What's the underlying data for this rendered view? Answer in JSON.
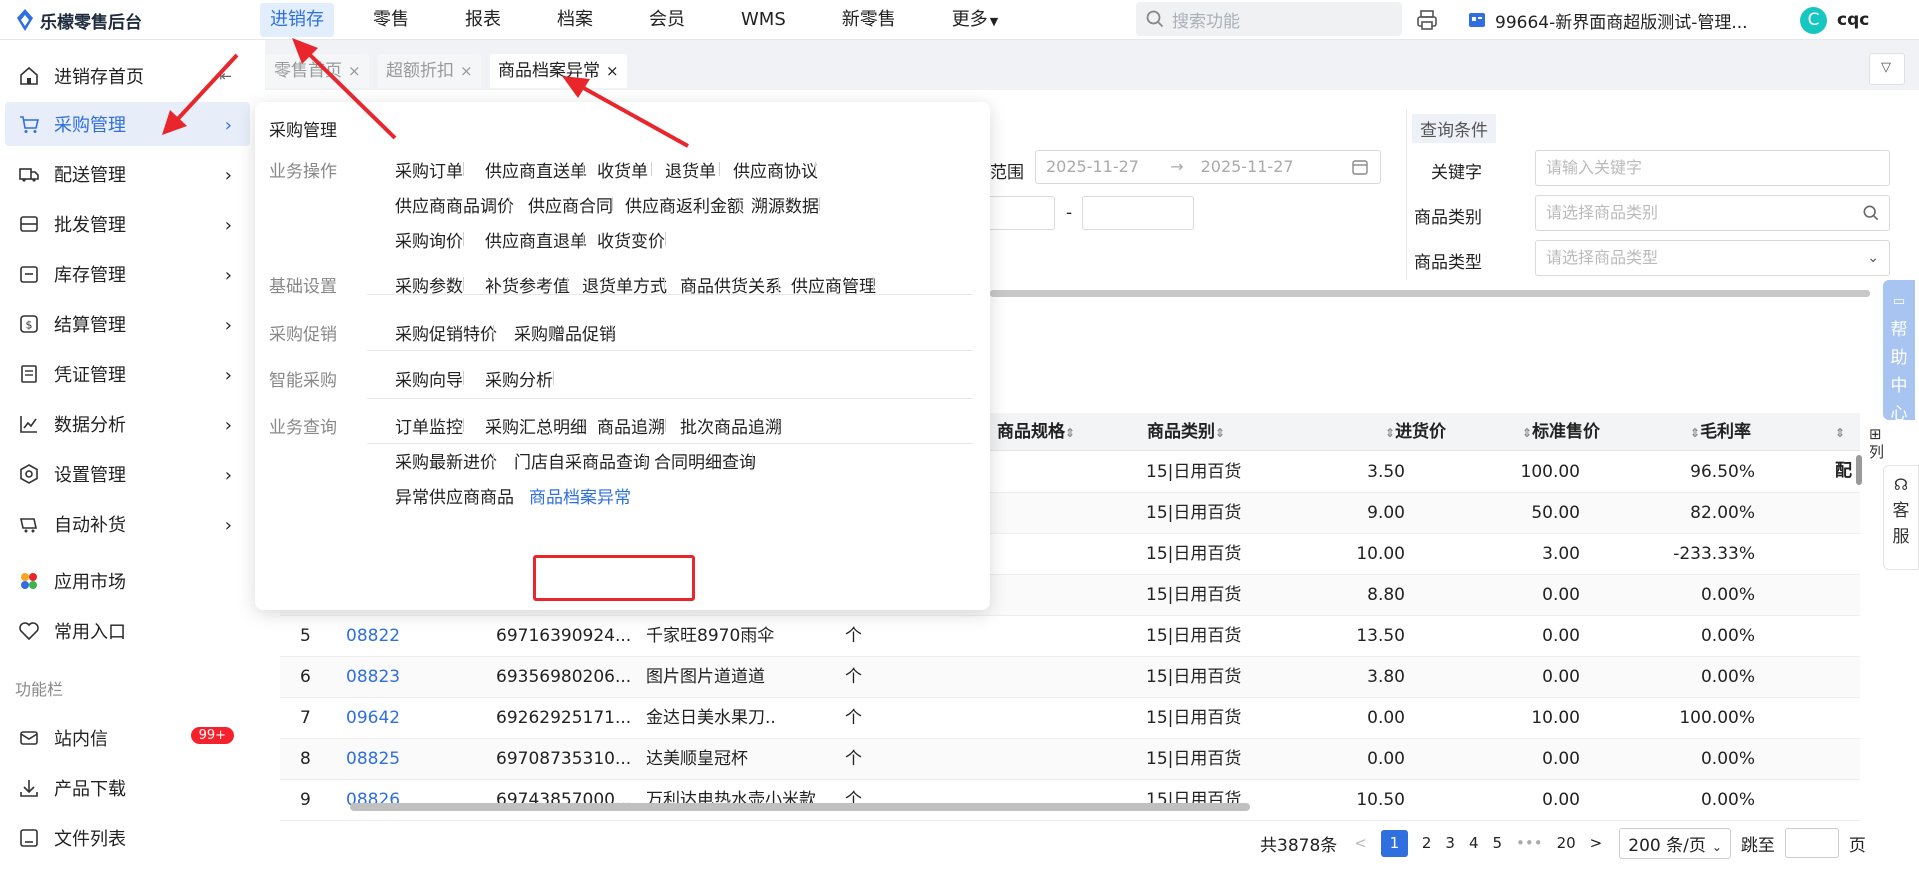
{
  "app": {
    "title": "乐檬零售后台"
  },
  "nav": [
    "进销存",
    "零售",
    "报表",
    "档案",
    "会员",
    "WMS",
    "新零售",
    "更多"
  ],
  "search": {
    "placeholder": "搜索功能"
  },
  "store": "99664-新界面商超版测试-管理...",
  "user": {
    "avatar": "C",
    "name": "cqc"
  },
  "sidebar": {
    "items": [
      "进销存首页",
      "采购管理",
      "配送管理",
      "批发管理",
      "库存管理",
      "结算管理",
      "凭证管理",
      "数据分析",
      "设置管理",
      "自动补货"
    ],
    "extra": [
      "应用市场",
      "常用入口"
    ],
    "section": "功能栏",
    "tools": [
      "站内信",
      "产品下载",
      "文件列表"
    ],
    "badge": "99+"
  },
  "tabs": [
    {
      "label": "零售首页",
      "close": "×"
    },
    {
      "label": "超额折扣",
      "close": "×"
    },
    {
      "label": "商品档案异常",
      "close": "×"
    }
  ],
  "query": {
    "title": "查询条件",
    "range_label": "范围",
    "date_from": "2025-11-27",
    "date_arrow": "→",
    "date_to": "2025-11-27",
    "dash": "-",
    "keyword_label": "关键字",
    "keyword_placeholder": "请输入关键字",
    "category_label": "商品类别",
    "category_placeholder": "请选择商品类别",
    "type_label": "商品类型",
    "type_placeholder": "请选择商品类型"
  },
  "table": {
    "headers": [
      "商品规格",
      "商品类别",
      "进货价",
      "标准售价",
      "毛利率",
      "配"
    ],
    "rows": [
      {
        "idx": "",
        "code": "",
        "barcode": "",
        "name": "",
        "unit": "",
        "category": "15|日用百货",
        "cost": "3.50",
        "price": "100.00",
        "margin": "96.50%"
      },
      {
        "idx": "",
        "code": "",
        "barcode": "",
        "name": "",
        "unit": "",
        "category": "15|日用百货",
        "cost": "9.00",
        "price": "50.00",
        "margin": "82.00%"
      },
      {
        "idx": "",
        "code": "",
        "barcode": "",
        "name": "",
        "unit": "",
        "category": "15|日用百货",
        "cost": "10.00",
        "price": "3.00",
        "margin": "-233.33%"
      },
      {
        "idx": "",
        "code": "",
        "barcode": "",
        "name": "",
        "unit": "",
        "category": "15|日用百货",
        "cost": "8.80",
        "price": "0.00",
        "margin": "0.00%"
      },
      {
        "idx": "5",
        "code": "08822",
        "barcode": "69716390924...",
        "name": "千家旺8970雨伞",
        "unit": "个",
        "category": "15|日用百货",
        "cost": "13.50",
        "price": "0.00",
        "margin": "0.00%"
      },
      {
        "idx": "6",
        "code": "08823",
        "barcode": "69356980206...",
        "name": "图片图片道道道",
        "unit": "个",
        "category": "15|日用百货",
        "cost": "3.80",
        "price": "0.00",
        "margin": "0.00%"
      },
      {
        "idx": "7",
        "code": "09642",
        "barcode": "69262925171...",
        "name": "金达日美水果刀..",
        "unit": "个",
        "category": "15|日用百货",
        "cost": "0.00",
        "price": "10.00",
        "margin": "100.00%"
      },
      {
        "idx": "8",
        "code": "08825",
        "barcode": "69708735310...",
        "name": "达美顺皇冠杯",
        "unit": "个",
        "category": "15|日用百货",
        "cost": "0.00",
        "price": "0.00",
        "margin": "0.00%"
      },
      {
        "idx": "9",
        "code": "08826",
        "barcode": "69743857000...",
        "name": "万利达电热水壶小米款",
        "unit": "个",
        "category": "15|日用百货",
        "cost": "10.50",
        "price": "0.00",
        "margin": "0.00%"
      }
    ]
  },
  "pager": {
    "total": "共3878条",
    "pages": [
      "1",
      "2",
      "3",
      "4",
      "5",
      "•••",
      "20"
    ],
    "prev": "<",
    "next": ">",
    "size": "200 条/页",
    "jump_label": "跳至",
    "page_unit": "页"
  },
  "right": {
    "column_label": "列",
    "help": [
      "帮",
      "助",
      "中",
      "心"
    ],
    "service": [
      "客",
      "服"
    ]
  },
  "menu": {
    "title": "采购管理",
    "sections": [
      {
        "name": "业务操作",
        "rows": [
          [
            "采购订单",
            "供应商直送单",
            "收货单",
            "退货单",
            "供应商协议"
          ],
          [
            "供应商商品调价",
            "供应商合同",
            "供应商返利金额",
            "溯源数据"
          ],
          [
            "采购询价",
            "供应商直退单",
            "收货变价"
          ]
        ]
      },
      {
        "name": "基础设置",
        "rows": [
          [
            "采购参数",
            "补货参考值",
            "退货单方式",
            "商品供货关系",
            "供应商管理"
          ]
        ]
      },
      {
        "name": "采购促销",
        "rows": [
          [
            "采购促销特价",
            "采购赠品促销"
          ]
        ]
      },
      {
        "name": "智能采购",
        "rows": [
          [
            "采购向导",
            "采购分析"
          ]
        ]
      },
      {
        "name": "业务查询",
        "rows": [
          [
            "订单监控",
            "采购汇总明细",
            "商品追溯",
            "批次商品追溯"
          ],
          [
            "采购最新进价",
            "门店自采商品查询",
            "合同明细查询"
          ],
          [
            "异常供应商商品",
            "商品档案异常"
          ]
        ]
      }
    ]
  },
  "colors": {
    "accent": "#2f6fe0",
    "highlight": "#e8262c"
  }
}
